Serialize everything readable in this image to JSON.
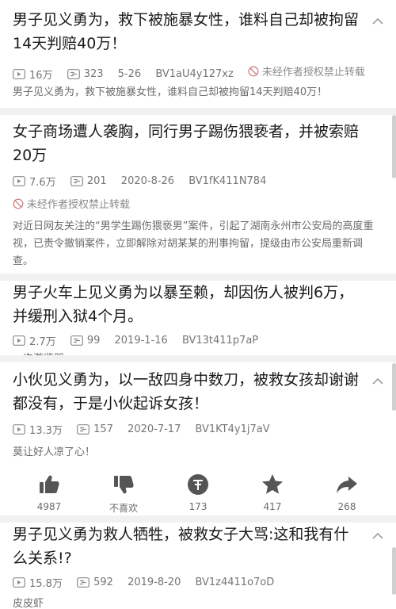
{
  "cards": [
    {
      "title": "男子见义勇为，救下被施暴女性，谁料自己却被拘留14天判赔40万！",
      "views": "16万",
      "comments": "323",
      "date": "5-26",
      "bvid": "BV1aU4y127xz",
      "warning": "未经作者授权禁止转载",
      "desc": "男子见义勇为，救下被施暴女性，谁料自己却被拘留14天判赔40万！"
    },
    {
      "title": "女子商场遭人袭胸，同行男子踢伤猥亵者，并被索赔20万",
      "views": "7.6万",
      "comments": "201",
      "date": "2020-8-26",
      "bvid": "BV1fK411N784",
      "warning": "未经作者授权禁止转载",
      "desc": "对近日网友关注的“男学生踢伤猥亵男”案件，引起了湖南永州市公安局的高度重视，已责令撤销案件，立即解除对胡某某的刑事拘留，提级由市公安局重新调查。"
    },
    {
      "title": "男子火车上见义勇为以暴至赖，却因伤人被判6万，并缓刑入狱4个月。",
      "views": "2.7万",
      "comments": "99",
      "date": "2019-1-16",
      "bvid": "BV13t411p7aP",
      "desc": "一次游览器"
    },
    {
      "title": "小伙见义勇为，以一敌四身中数刀，被救女孩却谢谢都没有，于是小伙起诉女孩！",
      "views": "13.3万",
      "comments": "157",
      "date": "2020-7-17",
      "bvid": "BV1KT4y1j7aV",
      "desc": "莫让好人凉了心！",
      "actions": [
        {
          "icon": "thumbs-up-icon",
          "label": "4987"
        },
        {
          "icon": "thumbs-down-icon",
          "label": "不喜欢"
        },
        {
          "icon": "coin-icon",
          "label": "173"
        },
        {
          "icon": "star-icon",
          "label": "417"
        },
        {
          "icon": "share-icon",
          "label": "268"
        }
      ]
    },
    {
      "title": "男子见义勇为救人牺牲，被救女子大骂:这和我有什么关系!?",
      "views": "15.8万",
      "comments": "592",
      "date": "2019-8-20",
      "bvid": "BV1z4411o7oD",
      "desc": "皮皮虾"
    }
  ],
  "colors": {
    "text": "#1a1a1a",
    "meta": "#757575",
    "divider": "#f1f1f1"
  }
}
